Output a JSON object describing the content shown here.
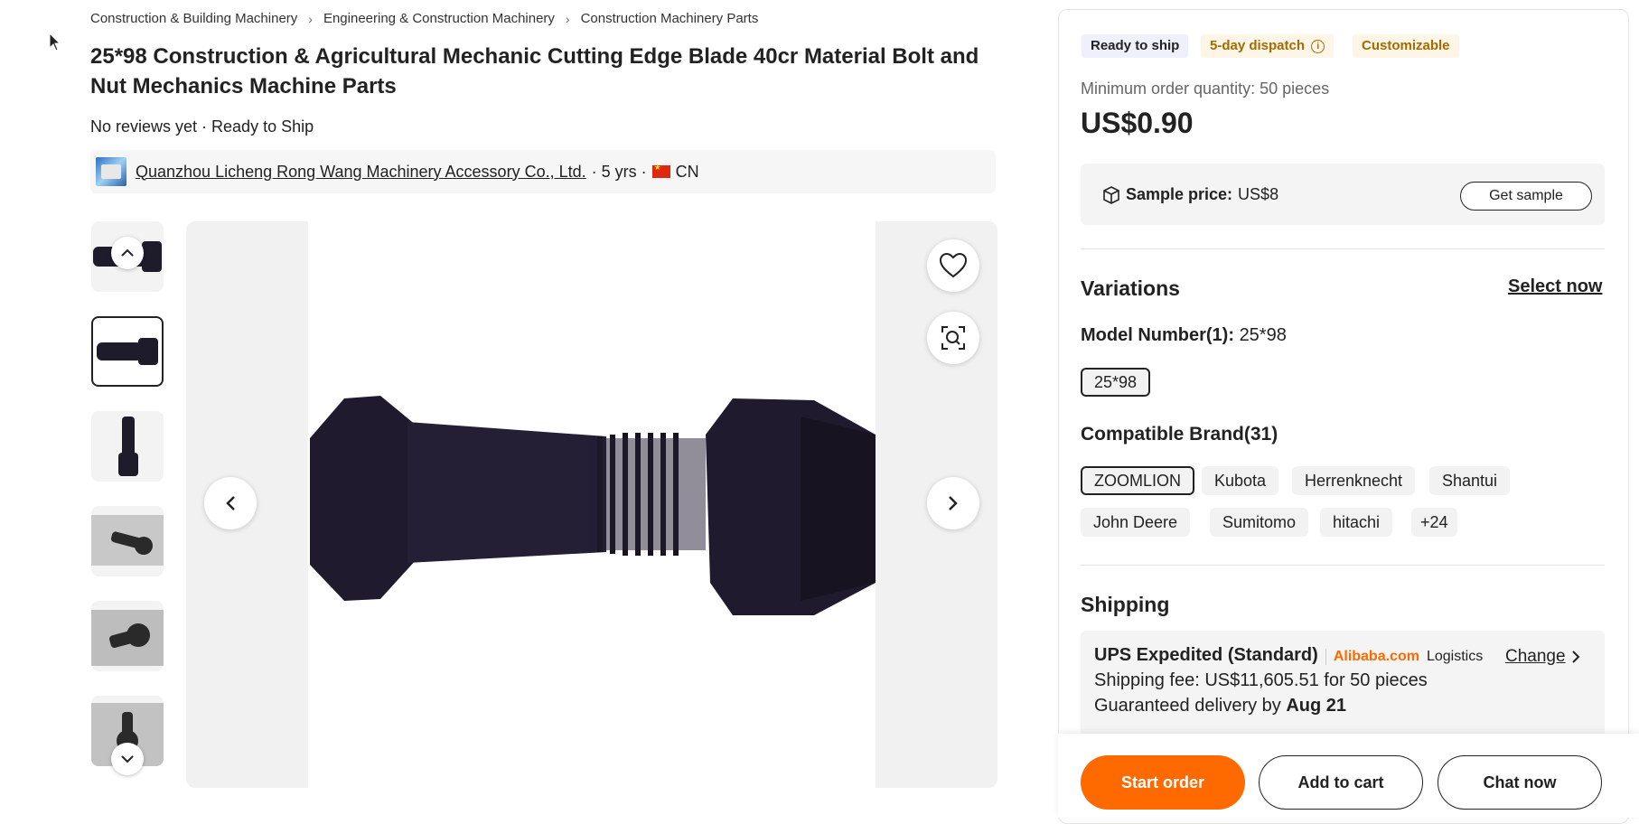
{
  "breadcrumb": [
    "Construction & Building Machinery",
    "Engineering & Construction Machinery",
    "Construction Machinery Parts"
  ],
  "product": {
    "title": "25*98 Construction & Agricultural Mechanic Cutting Edge Blade 40cr Material Bolt and Nut Mechanics Machine Parts",
    "reviews": "No reviews yet · Ready to Ship"
  },
  "supplier": {
    "name": "Quanzhou Licheng Rong Wang Machinery Accessory Co., Ltd.",
    "years": "· 5 yrs ·",
    "country": "CN"
  },
  "tags": {
    "ready": "Ready to ship",
    "dispatch": "5-day dispatch",
    "custom": "Customizable"
  },
  "pricing": {
    "moq": "Minimum order quantity: 50 pieces",
    "price": "US$0.90",
    "sample_label": "Sample price:",
    "sample_value": "US$8",
    "get_sample": "Get sample"
  },
  "variations": {
    "heading": "Variations",
    "select_now": "Select now",
    "model_label": "Model Number(1):",
    "model_value": "25*98",
    "model_chips": [
      "25*98"
    ],
    "brand_label": "Compatible Brand(31)",
    "brand_chips": [
      "ZOOMLION",
      "Kubota",
      "Herrenknecht",
      "Shantui",
      "John Deere",
      "Sumitomo",
      "hitachi",
      "+24"
    ]
  },
  "shipping": {
    "heading": "Shipping",
    "method": "UPS Expedited (Standard)",
    "carrier": "Alibaba.com",
    "carrier_suffix": "Logistics",
    "change": "Change",
    "fee": "Shipping fee: US$11,605.51 for 50 pieces",
    "delivery_prefix": "Guaranteed delivery by",
    "delivery_date": "Aug 21"
  },
  "actions": {
    "start_order": "Start order",
    "add_to_cart": "Add to cart",
    "chat_now": "Chat now"
  },
  "colors": {
    "accent": "#ff6a00",
    "dispatch_text": "#a56a00"
  }
}
